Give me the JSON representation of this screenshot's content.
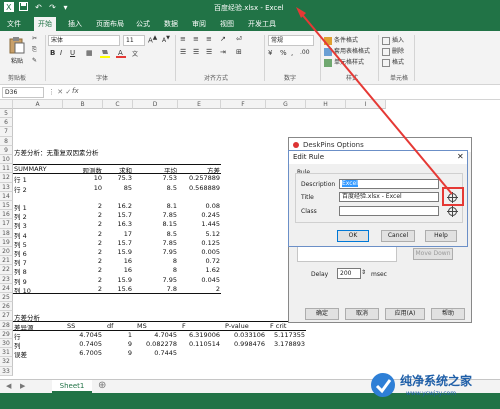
{
  "titlebar": {
    "title": "百度经验.xlsx - Excel"
  },
  "tabs": [
    "文件",
    "开始",
    "插入",
    "页面布局",
    "公式",
    "数据",
    "审阅",
    "视图",
    "开发工具"
  ],
  "ribbon": {
    "paste_label": "粘贴",
    "font_name": "宋体",
    "font_size": "11",
    "number_format": "常规",
    "groups": [
      "剪贴板",
      "字体",
      "对齐方式",
      "数字",
      "样式",
      "单元格"
    ],
    "style_items": [
      "条件格式",
      "套用表格格式",
      "单元格样式"
    ],
    "cell_items": [
      "插入",
      "删除",
      "格式"
    ]
  },
  "formula_bar": {
    "name_box": "D36",
    "fx": "fx"
  },
  "columns": [
    "A",
    "B",
    "C",
    "D",
    "E",
    "F",
    "G",
    "H",
    "I"
  ],
  "rows": [
    "5",
    "6",
    "7",
    "8",
    "9",
    "10",
    "11",
    "12",
    "13",
    "14",
    "15",
    "16",
    "17",
    "18",
    "19",
    "20",
    "21",
    "22",
    "23",
    "24",
    "25",
    "26",
    "27",
    "28",
    "29",
    "30",
    "31",
    "32",
    "33"
  ],
  "sheet": {
    "title_row": "方差分析：无重复双因素分析",
    "summary_header": [
      "SUMMARY",
      "观测数",
      "求和",
      "平均",
      "方差"
    ],
    "summary_rows": [
      [
        "行 1",
        "10",
        "75.3",
        "7.53",
        "0.257889"
      ],
      [
        "行 2",
        "10",
        "85",
        "8.5",
        "0.568889"
      ],
      [
        "列 1",
        "2",
        "16.2",
        "8.1",
        "0.08"
      ],
      [
        "列 2",
        "2",
        "15.7",
        "7.85",
        "0.245"
      ],
      [
        "列 3",
        "2",
        "16.3",
        "8.15",
        "1.445"
      ],
      [
        "列 4",
        "2",
        "17",
        "8.5",
        "5.12"
      ],
      [
        "列 5",
        "2",
        "15.7",
        "7.85",
        "0.125"
      ],
      [
        "列 6",
        "2",
        "15.9",
        "7.95",
        "0.005"
      ],
      [
        "列 7",
        "2",
        "16",
        "8",
        "0.72"
      ],
      [
        "列 8",
        "2",
        "16",
        "8",
        "1.62"
      ],
      [
        "列 9",
        "2",
        "15.9",
        "7.95",
        "0.045"
      ],
      [
        "列 10",
        "2",
        "15.6",
        "7.8",
        "2"
      ]
    ],
    "anova_title": "方差分析",
    "anova_header": [
      "差异源",
      "SS",
      "df",
      "MS",
      "F",
      "P-value",
      "F crit"
    ],
    "anova_rows": [
      [
        "行",
        "4.7045",
        "1",
        "4.7045",
        "6.319006",
        "0.033106",
        "5.117355"
      ],
      [
        "列",
        "0.7405",
        "9",
        "0.082278",
        "0.110514",
        "0.998476",
        "3.178893"
      ],
      [
        "误差",
        "6.7005",
        "9",
        "0.7445",
        "",
        "",
        ""
      ]
    ]
  },
  "sheet_tab": "Sheet1",
  "deskpins": {
    "title": "DeskPins Options",
    "delay_label": "Delay",
    "delay_value": "200",
    "delay_unit": "msec",
    "move_down": "Move Down",
    "buttons": [
      "确定",
      "取消",
      "应用(A)",
      "帮助"
    ]
  },
  "edit_rule": {
    "title": "Edit Rule",
    "group_label": "Rule",
    "description_label": "Description",
    "description_value": "Excel",
    "title_label": "Title",
    "title_value": "百度经验.xlsx - Excel",
    "class_label": "Class",
    "class_value": "",
    "ok": "OK",
    "cancel": "Cancel",
    "help": "Help"
  },
  "watermark": {
    "name": "纯净系统之家",
    "url": "www.ycwjzy.com"
  },
  "colors": {
    "excel_green": "#217346",
    "arrow_red": "#e53935",
    "highlight_blue": "#3399ff"
  }
}
